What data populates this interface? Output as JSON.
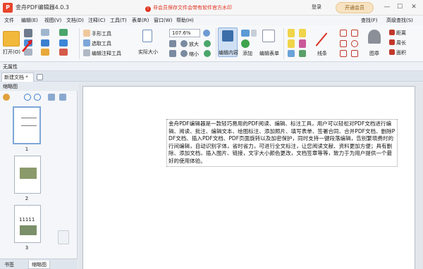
{
  "titlebar": {
    "app_title": "金舟PDF编辑器4.0.3",
    "notice": "非会员保存文件会带有软件官方水印",
    "login": "登录",
    "vip_button": "开通会员",
    "minimize": "—",
    "maximize": "☐",
    "close": "✕"
  },
  "menu": {
    "items": [
      "文件",
      "编辑(E)",
      "视图(V)",
      "文档(D)",
      "注释(C)",
      "工具(T)",
      "表单(R)",
      "窗口(W)",
      "帮助(H)"
    ],
    "find": "查找(F)",
    "advanced_find": "高级查找(S)"
  },
  "ribbon": {
    "open": "打开(O)",
    "hand_tool": "手形工具",
    "select_text": "选取工具",
    "edit_annot": "编辑注释工具",
    "actual_size": "实际大小",
    "zoom_value": "107.6%",
    "zoom_in": "放大",
    "zoom_out": "缩小",
    "edit_content": "编辑内容",
    "add": "添加",
    "edit_form": "编辑表单",
    "line": "线条",
    "stamp": "图章",
    "distance": "距离",
    "perimeter": "周长",
    "area": "面积"
  },
  "label_tool": "无属性",
  "tabs": {
    "doc_tab": "新建文档 *"
  },
  "left_panel": {
    "title": "缩略图",
    "thumbs": [
      {
        "num": "1"
      },
      {
        "num": "2"
      },
      {
        "num": "3",
        "content": "11111"
      }
    ],
    "bottom_tabs": [
      "书签",
      "缩略图"
    ]
  },
  "page": {
    "text": "金舟PDF编辑器是一款轻巧易用的PDF阅读、编辑、标注工具，用户可以轻松对PDF文档进行编辑、阅读、批注、编辑文本、绘图标注、添加照片、填写表单、签署合同、合并PDF文档、删除PDF文档、插入PDF文档、PDF页面旋转以及加密保护，同时支持一键段落编辑，告别繁琐费时的行间编辑，自动识别字体，省时省力，可进行全文标注，让您阅读文献、资料更加方便；具有删除、添加文档，插入图片、链接，文字大小颜色更改，文档签章等等，致力于为用户提供一个最好的使用体验。"
  },
  "colors": {
    "accent": "#2b7bd4",
    "brand": "#e8442c",
    "notice": "#e0321e",
    "vip": "#f7e3c2"
  }
}
